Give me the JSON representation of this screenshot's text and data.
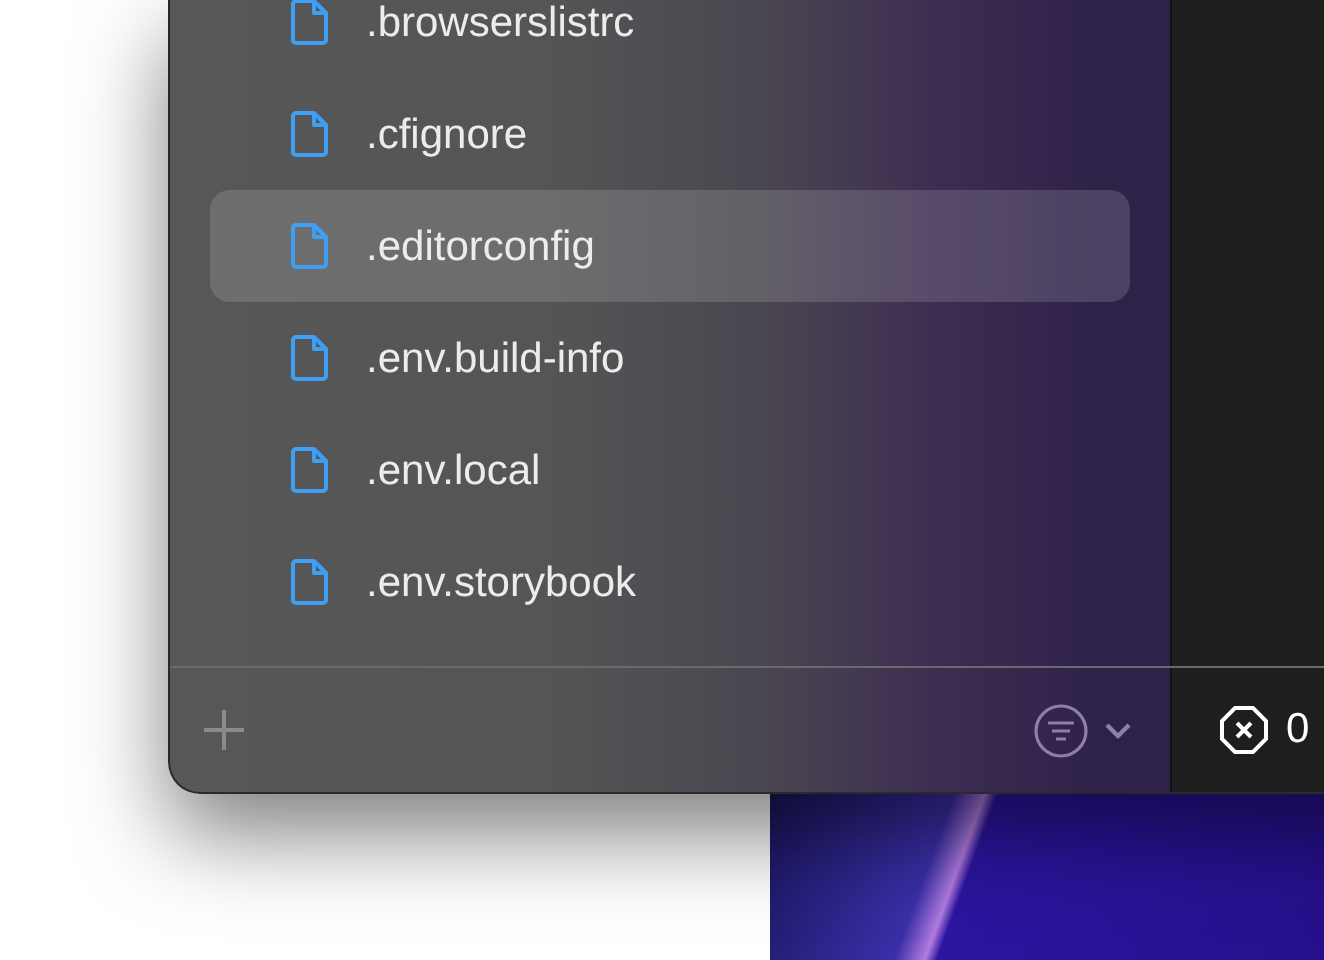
{
  "sidebar": {
    "files": [
      {
        "name": ".browserslistrc",
        "selected": false
      },
      {
        "name": ".cfignore",
        "selected": false
      },
      {
        "name": ".editorconfig",
        "selected": true
      },
      {
        "name": ".env.build-info",
        "selected": false
      },
      {
        "name": ".env.local",
        "selected": false
      },
      {
        "name": ".env.storybook",
        "selected": false
      }
    ]
  },
  "status_bar": {
    "error_count": "0"
  }
}
